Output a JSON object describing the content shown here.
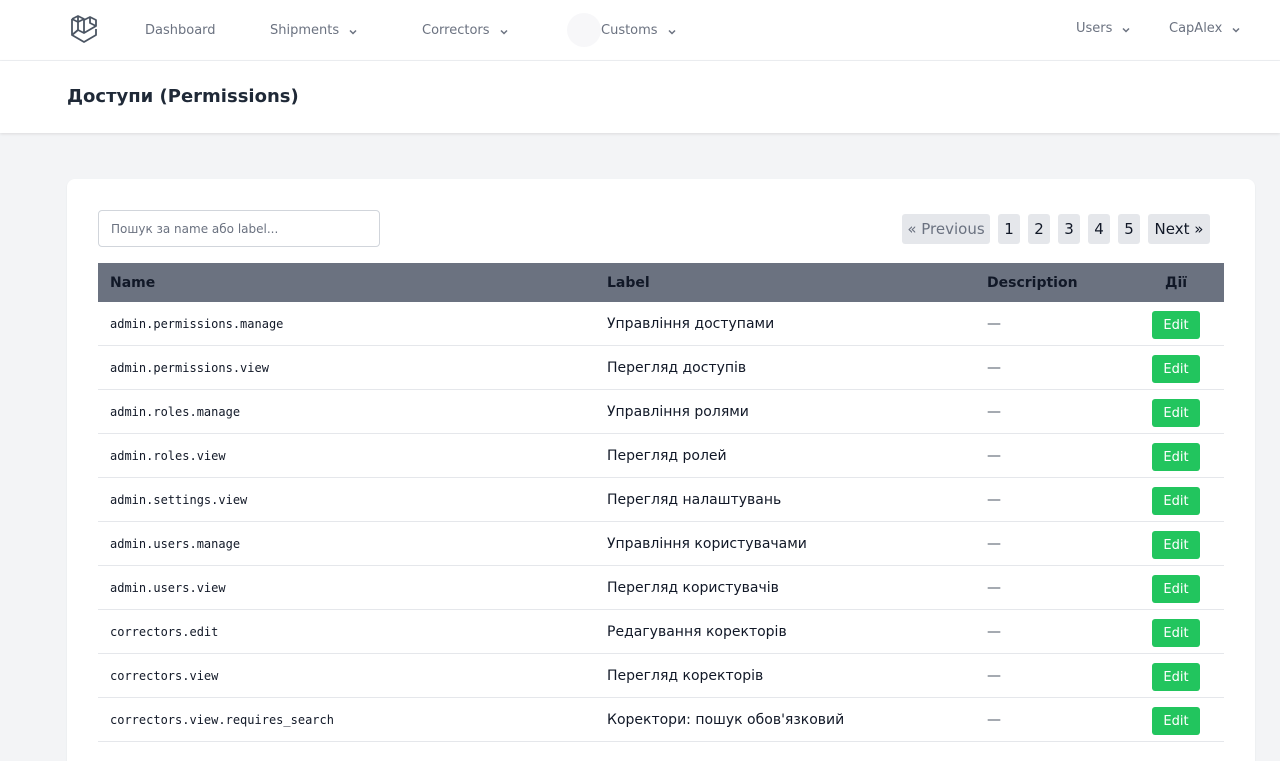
{
  "nav": {
    "logo_icon": "laravel-logo-icon",
    "dashboard": "Dashboard",
    "shipments": "Shipments",
    "correctors": "Correctors",
    "customs": "Customs",
    "users": "Users",
    "user": "CapAlex"
  },
  "page": {
    "title": "Доступи (Permissions)"
  },
  "search": {
    "placeholder": "Пошук за name або label..."
  },
  "pagination": {
    "prev": "« Previous",
    "pages": [
      "1",
      "2",
      "3",
      "4",
      "5"
    ],
    "next": "Next »"
  },
  "table": {
    "headers": {
      "name": "Name",
      "label": "Label",
      "description": "Description",
      "actions": "Дії"
    },
    "edit_label": "Edit",
    "rows": [
      {
        "name": "admin.permissions.manage",
        "label": "Управління доступами",
        "description": "—"
      },
      {
        "name": "admin.permissions.view",
        "label": "Перегляд доступів",
        "description": "—"
      },
      {
        "name": "admin.roles.manage",
        "label": "Управління ролями",
        "description": "—"
      },
      {
        "name": "admin.roles.view",
        "label": "Перегляд ролей",
        "description": "—"
      },
      {
        "name": "admin.settings.view",
        "label": "Перегляд налаштувань",
        "description": "—"
      },
      {
        "name": "admin.users.manage",
        "label": "Управління користувачами",
        "description": "—"
      },
      {
        "name": "admin.users.view",
        "label": "Перегляд користувачів",
        "description": "—"
      },
      {
        "name": "correctors.edit",
        "label": "Редагування коректорів",
        "description": "—"
      },
      {
        "name": "correctors.view",
        "label": "Перегляд коректорів",
        "description": "—"
      },
      {
        "name": "correctors.view.requires_search",
        "label": "Коректори: пошук обов'язковий",
        "description": "—"
      }
    ]
  },
  "colors": {
    "accent_green": "#22c55e",
    "table_header_bg": "#6b7280"
  }
}
